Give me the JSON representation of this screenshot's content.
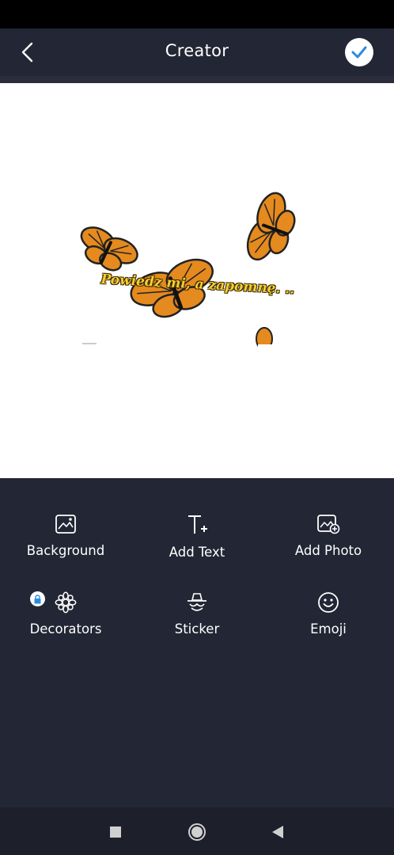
{
  "header": {
    "title": "Creator",
    "back_icon": "chevron-left-icon",
    "confirm_icon": "check-icon",
    "accent_color": "#2a8ce0"
  },
  "canvas": {
    "caption": "Powiedz mi, a zapomnę. ..",
    "image": "monarch-butterflies-artwork"
  },
  "tools": [
    {
      "label": "Background",
      "icon": "image-icon"
    },
    {
      "label": "Add Text",
      "icon": "text-add-icon"
    },
    {
      "label": "Add Photo",
      "icon": "add-photo-icon"
    },
    {
      "label": "Decorators",
      "icon": "ornament-icon",
      "locked": true
    },
    {
      "label": "Sticker",
      "icon": "sticker-icon"
    },
    {
      "label": "Emoji",
      "icon": "smiley-icon"
    }
  ],
  "navbar": {
    "items": [
      "recents-icon",
      "home-icon",
      "back-triangle-icon"
    ]
  }
}
